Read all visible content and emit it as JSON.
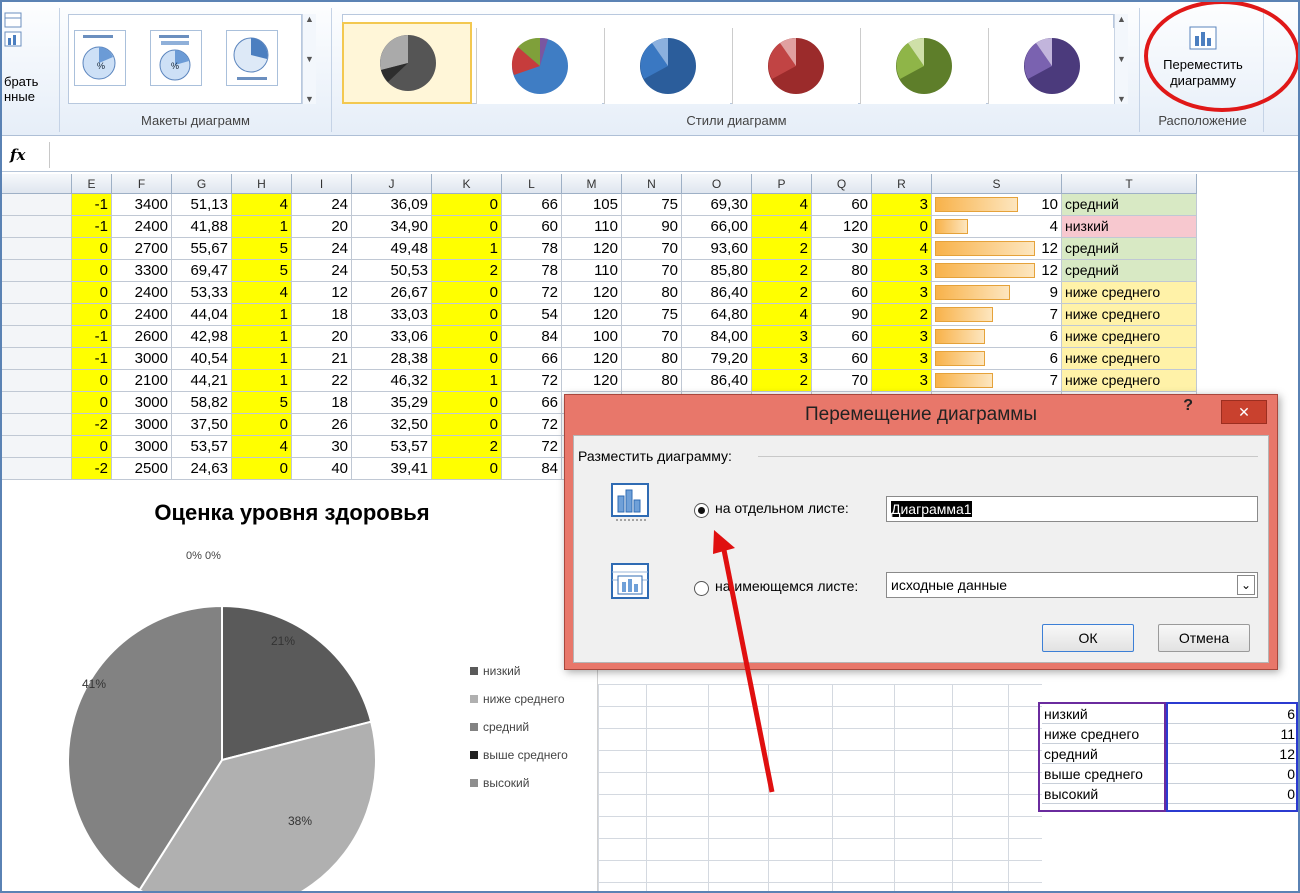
{
  "ribbon": {
    "select_data_partial": "брать\nнные",
    "layouts_label": "Макеты диаграмм",
    "styles_label": "Стили диаграмм",
    "move_chart_label": "Переместить диаграмму",
    "location_label": "Расположение"
  },
  "formula_bar": {
    "fx": "fx"
  },
  "columns": [
    "E",
    "F",
    "G",
    "H",
    "I",
    "J",
    "K",
    "L",
    "M",
    "N",
    "O",
    "P",
    "Q",
    "R",
    "S",
    "T"
  ],
  "rows": [
    [
      "-1",
      "3400",
      "51,13",
      "4",
      "24",
      "36,09",
      "0",
      "66",
      "105",
      "75",
      "69,30",
      "4",
      "60",
      "3",
      "10",
      "средний"
    ],
    [
      "-1",
      "2400",
      "41,88",
      "1",
      "20",
      "34,90",
      "0",
      "60",
      "110",
      "90",
      "66,00",
      "4",
      "120",
      "0",
      "4",
      "низкий"
    ],
    [
      "0",
      "2700",
      "55,67",
      "5",
      "24",
      "49,48",
      "1",
      "78",
      "120",
      "70",
      "93,60",
      "2",
      "30",
      "4",
      "12",
      "средний"
    ],
    [
      "0",
      "3300",
      "69,47",
      "5",
      "24",
      "50,53",
      "2",
      "78",
      "110",
      "70",
      "85,80",
      "2",
      "80",
      "3",
      "12",
      "средний"
    ],
    [
      "0",
      "2400",
      "53,33",
      "4",
      "12",
      "26,67",
      "0",
      "72",
      "120",
      "80",
      "86,40",
      "2",
      "60",
      "3",
      "9",
      "ниже среднего"
    ],
    [
      "0",
      "2400",
      "44,04",
      "1",
      "18",
      "33,03",
      "0",
      "54",
      "120",
      "75",
      "64,80",
      "4",
      "90",
      "2",
      "7",
      "ниже среднего"
    ],
    [
      "-1",
      "2600",
      "42,98",
      "1",
      "20",
      "33,06",
      "0",
      "84",
      "100",
      "70",
      "84,00",
      "3",
      "60",
      "3",
      "6",
      "ниже среднего"
    ],
    [
      "-1",
      "3000",
      "40,54",
      "1",
      "21",
      "28,38",
      "0",
      "66",
      "120",
      "80",
      "79,20",
      "3",
      "60",
      "3",
      "6",
      "ниже среднего"
    ],
    [
      "0",
      "2100",
      "44,21",
      "1",
      "22",
      "46,32",
      "1",
      "72",
      "120",
      "80",
      "86,40",
      "2",
      "70",
      "3",
      "7",
      "ниже среднего"
    ],
    [
      "0",
      "3000",
      "58,82",
      "5",
      "18",
      "35,29",
      "0",
      "66",
      "",
      "",
      "",
      "",
      "",
      "",
      "",
      ""
    ],
    [
      "-2",
      "3000",
      "37,50",
      "0",
      "26",
      "32,50",
      "0",
      "72",
      "",
      "",
      "",
      "",
      "",
      "",
      "",
      ""
    ],
    [
      "0",
      "3000",
      "53,57",
      "4",
      "30",
      "53,57",
      "2",
      "72",
      "",
      "",
      "",
      "",
      "",
      "",
      "",
      ""
    ],
    [
      "-2",
      "2500",
      "24,63",
      "0",
      "40",
      "39,41",
      "0",
      "84",
      "",
      "",
      "",
      "",
      "",
      "",
      "",
      ""
    ]
  ],
  "chart": {
    "title": "Оценка уровня здоровья",
    "top_labels": "0% 0%"
  },
  "chart_data": {
    "type": "pie",
    "title": "Оценка уровня здоровья",
    "categories": [
      "низкий",
      "ниже среднего",
      "средний",
      "выше среднего",
      "высокий"
    ],
    "values": [
      21,
      38,
      41,
      0,
      0
    ],
    "value_labels": [
      "21%",
      "38%",
      "41%"
    ],
    "colors": [
      "#5a5a5a",
      "#b0b0b0",
      "#828282",
      "#222222",
      "#8e8e8e"
    ]
  },
  "summary": [
    {
      "label": "низкий",
      "value": "6"
    },
    {
      "label": "ниже среднего",
      "value": "11"
    },
    {
      "label": "средний",
      "value": "12"
    },
    {
      "label": "выше среднего",
      "value": "0"
    },
    {
      "label": "высокий",
      "value": "0"
    }
  ],
  "dialog": {
    "title": "Перемещение диаграммы",
    "help": "?",
    "close": "✕",
    "group_label": "Разместить диаграмму:",
    "option1_label": "на отдельном листе:",
    "option1_value": "Диаграмма1",
    "option2_label": "на имеющемся листе:",
    "option2_value": "исходные данные",
    "ok": "ОК",
    "cancel": "Отмена"
  }
}
